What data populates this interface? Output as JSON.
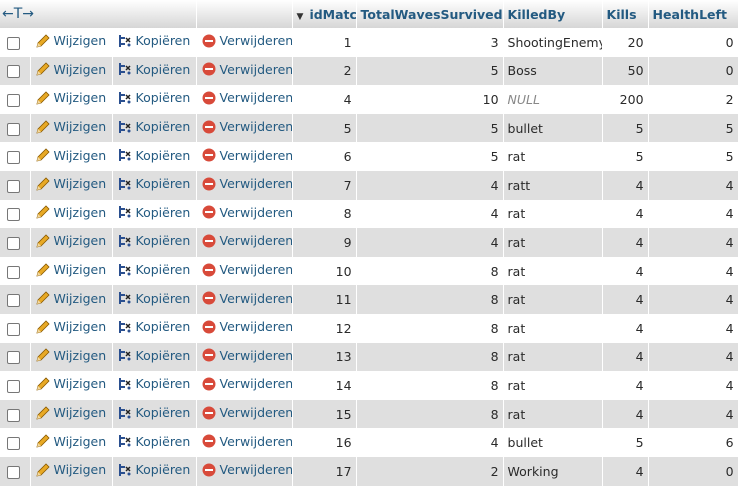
{
  "header": {
    "arrows": "←T→",
    "sort_marker": "▼",
    "columns": [
      "idMatch",
      "TotalWavesSurvived",
      "KilledBy",
      "Kills",
      "HealthLeft"
    ]
  },
  "actions": {
    "edit": "Wijzigen",
    "copy": "Kopiëren",
    "delete": "Verwijderen"
  },
  "rows": [
    {
      "idMatch": "1",
      "TotalWavesSurvived": "3",
      "KilledBy": "ShootingEnemy",
      "Kills": "20",
      "HealthLeft": "0"
    },
    {
      "idMatch": "2",
      "TotalWavesSurvived": "5",
      "KilledBy": "Boss",
      "Kills": "50",
      "HealthLeft": "0"
    },
    {
      "idMatch": "4",
      "TotalWavesSurvived": "10",
      "KilledBy": "NULL",
      "Kills": "200",
      "HealthLeft": "2"
    },
    {
      "idMatch": "5",
      "TotalWavesSurvived": "5",
      "KilledBy": "bullet",
      "Kills": "5",
      "HealthLeft": "5"
    },
    {
      "idMatch": "6",
      "TotalWavesSurvived": "5",
      "KilledBy": "rat",
      "Kills": "5",
      "HealthLeft": "5"
    },
    {
      "idMatch": "7",
      "TotalWavesSurvived": "4",
      "KilledBy": "ratt",
      "Kills": "4",
      "HealthLeft": "4"
    },
    {
      "idMatch": "8",
      "TotalWavesSurvived": "4",
      "KilledBy": "rat",
      "Kills": "4",
      "HealthLeft": "4"
    },
    {
      "idMatch": "9",
      "TotalWavesSurvived": "4",
      "KilledBy": "rat",
      "Kills": "4",
      "HealthLeft": "4"
    },
    {
      "idMatch": "10",
      "TotalWavesSurvived": "8",
      "KilledBy": "rat",
      "Kills": "4",
      "HealthLeft": "4"
    },
    {
      "idMatch": "11",
      "TotalWavesSurvived": "8",
      "KilledBy": "rat",
      "Kills": "4",
      "HealthLeft": "4"
    },
    {
      "idMatch": "12",
      "TotalWavesSurvived": "8",
      "KilledBy": "rat",
      "Kills": "4",
      "HealthLeft": "4"
    },
    {
      "idMatch": "13",
      "TotalWavesSurvived": "8",
      "KilledBy": "rat",
      "Kills": "4",
      "HealthLeft": "4"
    },
    {
      "idMatch": "14",
      "TotalWavesSurvived": "8",
      "KilledBy": "rat",
      "Kills": "4",
      "HealthLeft": "4"
    },
    {
      "idMatch": "15",
      "TotalWavesSurvived": "8",
      "KilledBy": "rat",
      "Kills": "4",
      "HealthLeft": "4"
    },
    {
      "idMatch": "16",
      "TotalWavesSurvived": "4",
      "KilledBy": "bullet",
      "Kills": "5",
      "HealthLeft": "6"
    },
    {
      "idMatch": "17",
      "TotalWavesSurvived": "2",
      "KilledBy": "Working",
      "Kills": "4",
      "HealthLeft": "0"
    }
  ],
  "null_value": "NULL",
  "colors": {
    "link": "#235a81",
    "row_even": "#dfdfdf",
    "row_odd": "#ffffff",
    "delete_icon": "#d84a3a",
    "edit_icon": "#e8a925"
  },
  "icons": {
    "edit": "pencil-icon",
    "copy": "copy-icon",
    "delete": "delete-icon"
  }
}
